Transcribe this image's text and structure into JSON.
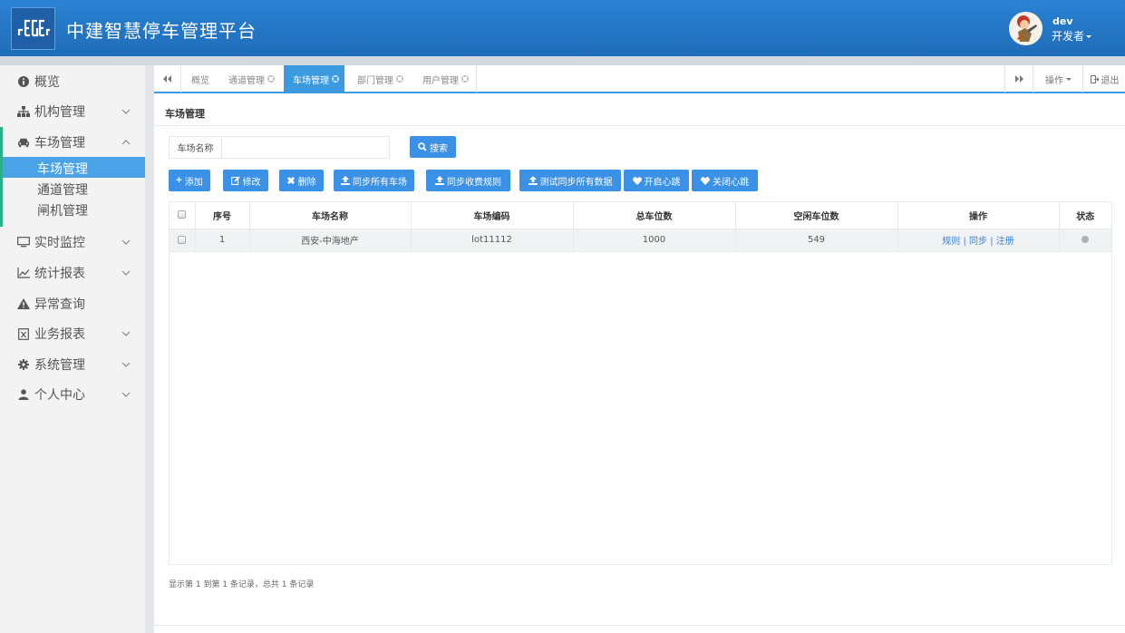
{
  "header": {
    "app_title": "中建智慧停车管理平台",
    "user_name": "dev",
    "user_role": "开发者"
  },
  "sidebar": {
    "items": [
      {
        "label": "概览",
        "icon": "info-circle-icon"
      },
      {
        "label": "机构管理",
        "icon": "sitemap-icon"
      },
      {
        "label": "车场管理",
        "icon": "car-icon"
      },
      {
        "label": "实时监控",
        "icon": "monitor-icon"
      },
      {
        "label": "统计报表",
        "icon": "line-chart-icon"
      },
      {
        "label": "异常查询",
        "icon": "warning-icon"
      },
      {
        "label": "业务报表",
        "icon": "excel-file-icon"
      },
      {
        "label": "系统管理",
        "icon": "gear-icon"
      },
      {
        "label": "个人中心",
        "icon": "user-icon"
      }
    ],
    "sub_items": [
      "车场管理",
      "通道管理",
      "闸机管理"
    ]
  },
  "tabs": {
    "items": [
      "概览",
      "通道管理",
      "车场管理",
      "部门管理",
      "用户管理"
    ],
    "active": "车场管理",
    "ops_label": "操作",
    "logout_label": "退出"
  },
  "page": {
    "heading": "车场管理",
    "search_label": "车场名称",
    "search_value": "",
    "search_button": "搜索"
  },
  "toolbar": {
    "add": "添加",
    "edit": "修改",
    "delete": "删除",
    "sync_lots": "同步所有车场",
    "sync_rules": "同步收费规则",
    "test_sync": "测试同步所有数据",
    "heartbeat_on": "开启心跳",
    "heartbeat_off": "关闭心跳"
  },
  "table": {
    "columns": [
      "序号",
      "车场名称",
      "车场编码",
      "总车位数",
      "空闲车位数",
      "操作",
      "状态"
    ],
    "rows": [
      {
        "index": "1",
        "name": "西安-中海地产",
        "code": "lot11112",
        "total": "1000",
        "free": "549",
        "op_rule": "规则",
        "op_sync": "同步",
        "op_register": "注册"
      }
    ],
    "pager_text": "显示第 1 到第 1 条记录，总共 1 条记录"
  },
  "colors": {
    "header_blue": "#2b82d4",
    "accent_blue": "#3b91e6",
    "active_tab": "#3b9ae0",
    "sidebar_bg": "#f3f3f4",
    "active_group_bar": "#2dae8c"
  }
}
